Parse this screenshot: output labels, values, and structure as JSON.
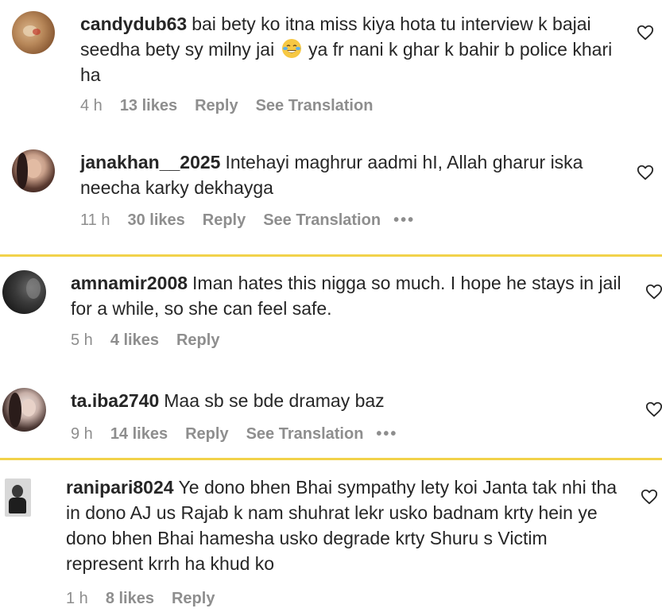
{
  "comments": [
    {
      "username": "candydub63",
      "text_before_emoji": "bai bety ko itna miss kiya hota tu interview k bajai seedha bety sy milny jai ",
      "emoji": "face-with-tears-of-joy",
      "text_after_emoji": " ya fr nani k ghar k bahir b police khari ha",
      "time": "4 h",
      "likes": "13 likes",
      "reply": "Reply",
      "translation": "See Translation"
    },
    {
      "username": "janakhan__2025",
      "text": "Intehayi maghrur aadmi hI, Allah gharur iska neecha karky dekhayga",
      "time": "11 h",
      "likes": "30 likes",
      "reply": "Reply",
      "translation": "See Translation",
      "more": "•••"
    },
    {
      "username": "amnamir2008",
      "text": "Iman hates this nigga so much. I hope he stays in jail for a while, so she can feel safe.",
      "time": "5 h",
      "likes": "4 likes",
      "reply": "Reply"
    },
    {
      "username": "ta.iba2740",
      "text": "Maa sb se bde dramay baz",
      "time": "9 h",
      "likes": "14 likes",
      "reply": "Reply",
      "translation": "See Translation",
      "more": "•••"
    },
    {
      "username": "ranipari8024",
      "text": "Ye dono bhen Bhai sympathy lety koi Janta tak nhi tha in dono AJ us Rajab k nam shuhrat lekr usko badnam krty hein ye dono bhen Bhai hamesha usko degrade krty Shuru s Victim represent krrh ha khud ko",
      "time": "1 h",
      "likes": "8 likes",
      "reply": "Reply"
    }
  ],
  "colors": {
    "separator": "#f2d24a",
    "text": "#262626",
    "meta": "#8e8e8e"
  }
}
